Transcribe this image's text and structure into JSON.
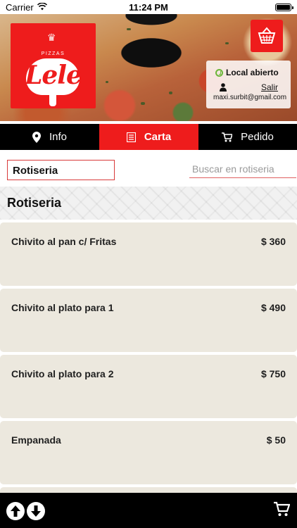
{
  "status_bar": {
    "carrier": "Carrier",
    "time": "11:24 PM"
  },
  "hero": {
    "logo": {
      "top_text": "PIZZAS",
      "name": "Lele"
    },
    "store_status": "Local abierto",
    "logout_label": "Salir",
    "user_email": "maxi.surbit@gmail.com"
  },
  "tabs": [
    {
      "label": "Info",
      "icon": "location-pin-icon",
      "active": false
    },
    {
      "label": "Carta",
      "icon": "menu-list-icon",
      "active": true
    },
    {
      "label": "Pedido",
      "icon": "cart-icon",
      "active": false
    }
  ],
  "category": {
    "selected": "Rotiseria"
  },
  "search": {
    "placeholder": "Buscar en rotiseria",
    "value": ""
  },
  "section": {
    "title": "Rotiseria"
  },
  "items": [
    {
      "name": "Chivito al pan c/ Fritas",
      "price": "$ 360"
    },
    {
      "name": "Chivito al plato para 1",
      "price": "$ 490"
    },
    {
      "name": "Chivito al plato para 2",
      "price": "$ 750"
    },
    {
      "name": "Empanada",
      "price": "$ 50"
    },
    {
      "name": "",
      "price": ""
    }
  ],
  "bottom_bar": {
    "scroll_up_icon": "arrow-up-icon",
    "scroll_down_icon": "arrow-down-icon",
    "cart_icon": "cart-icon"
  },
  "colors": {
    "brand_red": "#ee1c1c",
    "item_bg": "#ece8de",
    "bar_bg": "#000000",
    "open_green": "#6cb63a"
  }
}
